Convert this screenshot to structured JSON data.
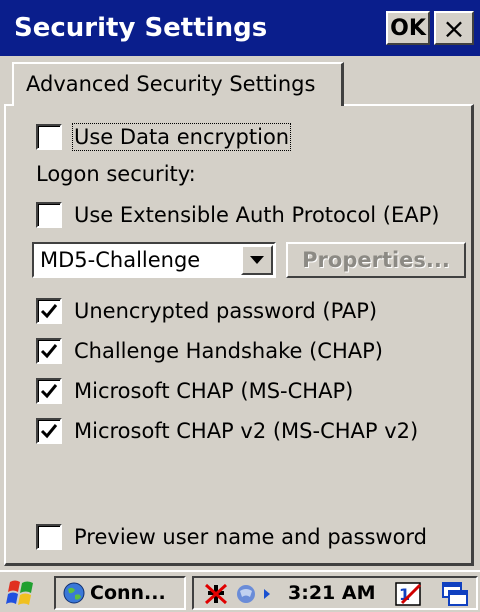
{
  "window": {
    "title": "Security Settings",
    "ok_label": "OK",
    "close_label": "×"
  },
  "tab": {
    "label": "Advanced Security Settings"
  },
  "options": {
    "data_encryption": {
      "label": "Use Data encryption",
      "checked": false
    },
    "logon_security_label": "Logon security:",
    "eap": {
      "label": "Use Extensible Auth Protocol (EAP)",
      "checked": false
    },
    "eap_type": {
      "value": "MD5-Challenge"
    },
    "properties_label": "Properties...",
    "pap": {
      "label": "Unencrypted password (PAP)",
      "checked": true
    },
    "chap": {
      "label": "Challenge Handshake  (CHAP)",
      "checked": true
    },
    "ms_chap": {
      "label": "Microsoft CHAP (MS-CHAP)",
      "checked": true
    },
    "ms_chap_v2": {
      "label": "Microsoft CHAP v2 (MS-CHAP v2)",
      "checked": true
    },
    "preview": {
      "label": "Preview user name and password",
      "checked": false
    }
  },
  "taskbar": {
    "task_label": "Conn...",
    "clock": "3:21 AM",
    "icons": [
      "start-flag-icon",
      "network-globe-icon",
      "network-disconnected-icon",
      "connection-arrow-icon",
      "input-panel-icon",
      "desktop-switch-icon"
    ]
  }
}
